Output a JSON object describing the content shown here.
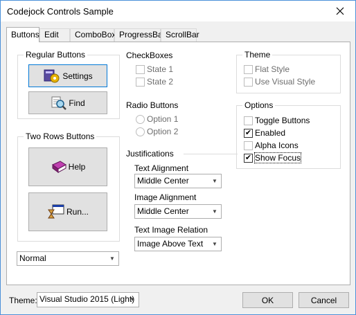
{
  "window": {
    "title": "Codejock Controls Sample"
  },
  "tabs": [
    "Buttons",
    "Edit",
    "ComboBox",
    "ProgressBar",
    "ScrollBar"
  ],
  "regular_buttons": {
    "title": "Regular Buttons",
    "settings": "Settings",
    "find": "Find"
  },
  "two_rows": {
    "title": "Two Rows Buttons",
    "help": "Help",
    "run": "Run..."
  },
  "style_combo": "Normal",
  "checkboxes": {
    "title": "CheckBoxes",
    "state1": "State 1",
    "state2": "State 2"
  },
  "radios": {
    "title": "Radio Buttons",
    "option1": "Option 1",
    "option2": "Option 2"
  },
  "justifications": {
    "title": "Justifications",
    "text_alignment_label": "Text Alignment",
    "text_alignment_value": "Middle Center",
    "image_alignment_label": "Image Alignment",
    "image_alignment_value": "Middle Center",
    "relation_label": "Text Image Relation",
    "relation_value": "Image Above Text"
  },
  "theme_group": {
    "title": "Theme",
    "flat": "Flat Style",
    "visual": "Use Visual Style"
  },
  "options": {
    "title": "Options",
    "toggle": "Toggle Buttons",
    "enabled": "Enabled",
    "alpha": "Alpha Icons",
    "show_focus": "Show Focus",
    "enabled_checked": true,
    "show_focus_checked": true
  },
  "footer": {
    "theme_label": "Theme:",
    "theme_value": "Visual Studio 2015 (Light)",
    "ok": "OK",
    "cancel": "Cancel"
  },
  "colors": {
    "focus": "#0078d7",
    "panel": "#ffffff",
    "window": "#f0f0f0"
  }
}
